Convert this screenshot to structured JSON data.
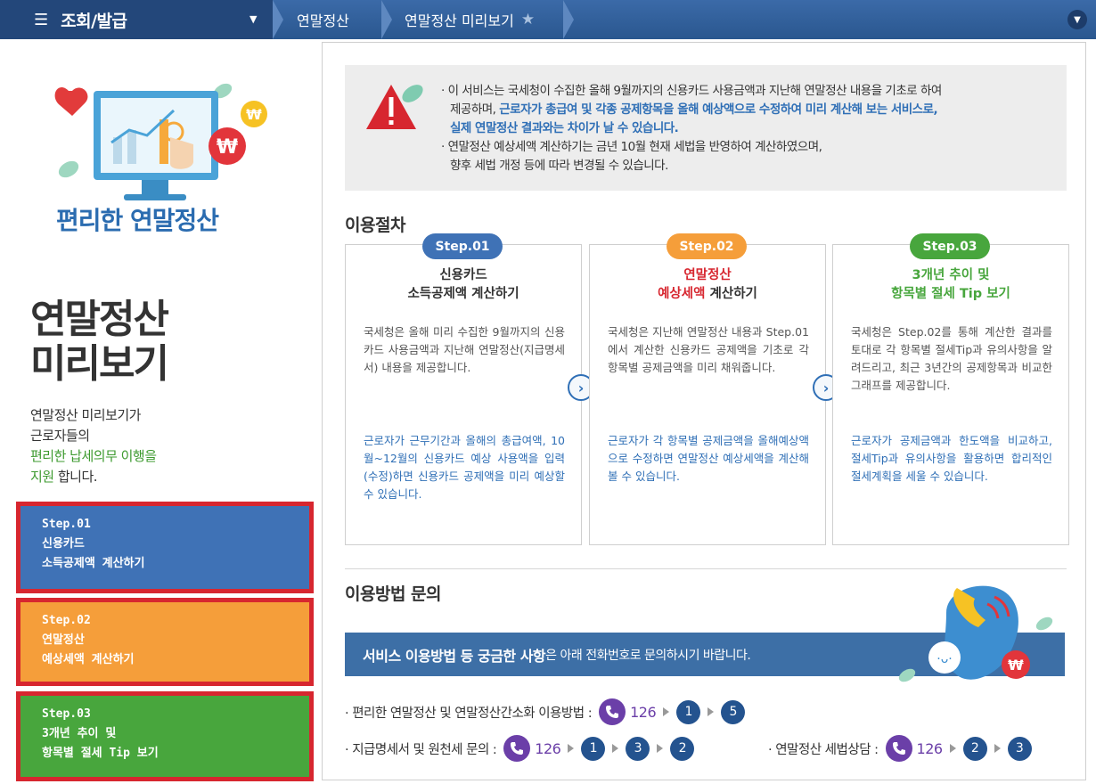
{
  "header": {
    "menu_icon": "hamburger-icon",
    "menu_title": "조회/발급",
    "breadcrumb": [
      "연말정산",
      "연말정산 미리보기"
    ],
    "colors": {
      "bar": "#2f5f9c",
      "menu": "#23477a"
    }
  },
  "sidebar": {
    "brand": "편리한 연말정산",
    "title_line1": "연말정산",
    "title_line2": "미리보기",
    "desc_line1": "연말정산 미리보기가",
    "desc_line2": "근로자들의",
    "desc_green1": "편리한 납세의무 이행을",
    "desc_green2": "지원",
    "desc_tail": " 합니다.",
    "steps": [
      {
        "l1": "Step.01",
        "l2": "신용카드",
        "l3": "소득공제액 계산하기"
      },
      {
        "l1": "Step.02",
        "l2": "연말정산",
        "l3": "예상세액 계산하기"
      },
      {
        "l1": "Step.03",
        "l2": "3개년 추이 및",
        "l3": "항목별 절세 Tip 보기"
      }
    ]
  },
  "notice": {
    "p1_a": "· 이 서비스는 국세청이 수집한 올해 9월까지의 신용카드 사용금액과 지난해 연말정산 내용을 기초로 하여",
    "p1_b": "제공하며, ",
    "p1_blue1": "근로자가 총급여 및 각종 공제항목을 올해 예상액으로 수정하여 미리 계산해 보는 서비스로,",
    "p1_blue2": "실제 연말정산 결과와는 차이가 날 수 있습니다.",
    "p2_a": "· 연말정산 예상세액 계산하기는 금년 10월 현재 세법을 반영하여 계산하였으며,",
    "p2_b": "향후 세법 개정 등에 따라 변경될 수 있습니다."
  },
  "procedure": {
    "title": "이용절차",
    "cards": [
      {
        "badge": "Step.01",
        "title_pre": "신용카드",
        "title_post": "소득공제액 계산하기",
        "body": "국세청은 올해 미리 수집한 9월까지의 신용카드 사용금액과 지난해 연말정산(지급명세서) 내용을 제공합니다.",
        "note": "근로자가 근무기간과 올해의 총급여액, 10월~12월의 신용카드 예상 사용액을 입력(수정)하면 신용카드 공제액을 미리 예상할 수 있습니다."
      },
      {
        "badge": "Step.02",
        "title_pre": "연말정산",
        "title_pre2": "예상세액",
        "title_post": " 계산하기",
        "body": "국세청은 지난해 연말정산 내용과 Step.01에서 계산한 신용카드 공제액을 기초로 각 항목별 공제금액을 미리 채워줍니다.",
        "note": "근로자가 각 항목별 공제금액을 올해예상액으로 수정하면 연말정산 예상세액을 계산해 볼 수 있습니다."
      },
      {
        "badge": "Step.03",
        "title_pre": "3개년 추이 및",
        "title_post": "항목별 절세 Tip 보기",
        "body": "국세청은 Step.02를 통해 계산한 결과를 토대로 각 항목별 절세Tip과 유의사항을 알려드리고, 최근 3년간의 공제항목과 비교한 그래프를 제공합니다.",
        "note": "근로자가 공제금액과 한도액을 비교하고, 절세Tip과 유의사항을 활용하면 합리적인 절세계획을 세울 수 있습니다."
      }
    ],
    "badge_colors": [
      "#3f72b6",
      "#f59e3a",
      "#48a63d"
    ]
  },
  "inquiry": {
    "title": "이용방법 문의",
    "banner_hl": "서비스 이용방법 등 궁금한 사항",
    "banner_rest": "은 아래 전화번호로 문의하시기 바랍니다.",
    "line1_label": "· 편리한 연말정산 및 연말정산간소화 이용방법 :",
    "line2_label": "· 지급명세서 및 원천세 문의 :",
    "line3_label": "· 연말정산 세법상담 :",
    "phone": "126",
    "line1_seq": [
      "1",
      "5"
    ],
    "line2_seq": [
      "1",
      "3",
      "2"
    ],
    "line3_seq": [
      "2",
      "3"
    ]
  }
}
